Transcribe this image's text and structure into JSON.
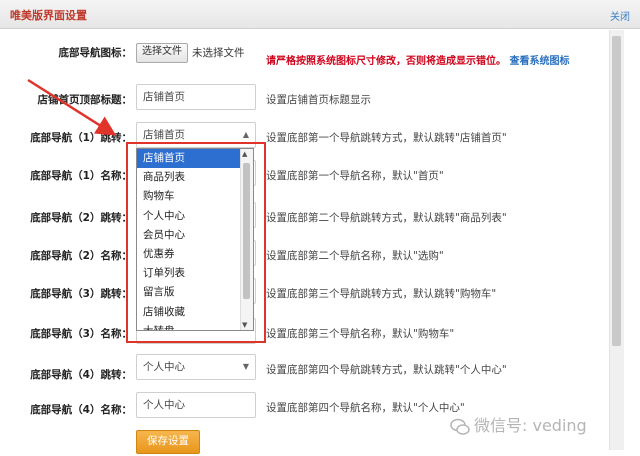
{
  "window": {
    "title": "唯美版界面设置",
    "close_label": "关闭"
  },
  "file_row": {
    "label": "底部导航图标：",
    "button": "选择文件",
    "file_status": "未选择文件"
  },
  "warning": {
    "text": "请严格按照系统图标尺寸修改，否则将造成显示错位。",
    "link": "查看系统图标"
  },
  "rows": [
    {
      "label": "店铺首页顶部标题：",
      "value": "店铺首页",
      "hint": "设置店铺首页标题显示"
    },
    {
      "label": "底部导航（1）跳转：",
      "value": "店铺首页",
      "hint": "设置底部第一个导航跳转方式，默认跳转\"店铺首页\""
    },
    {
      "label": "底部导航（1）名称：",
      "value": "",
      "hint": "设置底部第一个导航名称，默认\"首页\""
    },
    {
      "label": "底部导航（2）跳转：",
      "value": "",
      "hint": "设置底部第二个导航跳转方式，默认跳转\"商品列表\""
    },
    {
      "label": "底部导航（2）名称：",
      "value": "",
      "hint": "设置底部第二个导航名称，默认\"选购\""
    },
    {
      "label": "底部导航（3）跳转：",
      "value": "",
      "hint": "设置底部第三个导航跳转方式，默认跳转\"购物车\""
    },
    {
      "label": "底部导航（3）名称：",
      "value": "",
      "hint": "设置底部第三个导航名称，默认\"购物车\""
    },
    {
      "label": "底部导航（4）跳转：",
      "value": "个人中心",
      "hint": "设置底部第四个导航跳转方式，默认跳转\"个人中心\""
    },
    {
      "label": "底部导航（4）名称：",
      "value": "个人中心",
      "hint": "设置底部第四个导航名称，默认\"个人中心\""
    }
  ],
  "dropdown": {
    "options": [
      "店铺首页",
      "商品列表",
      "购物车",
      "个人中心",
      "会员中心",
      "优惠券",
      "订单列表",
      "留言版",
      "店铺收藏",
      "大转盘"
    ],
    "selected_index": 0
  },
  "save_button": "保存设置",
  "watermark": "微信号: veding",
  "colors": {
    "warning": "#d0021b",
    "link": "#2a6fbf",
    "selection": "#2d6fd1",
    "save": "#e8961b",
    "callout": "#e0342b"
  }
}
